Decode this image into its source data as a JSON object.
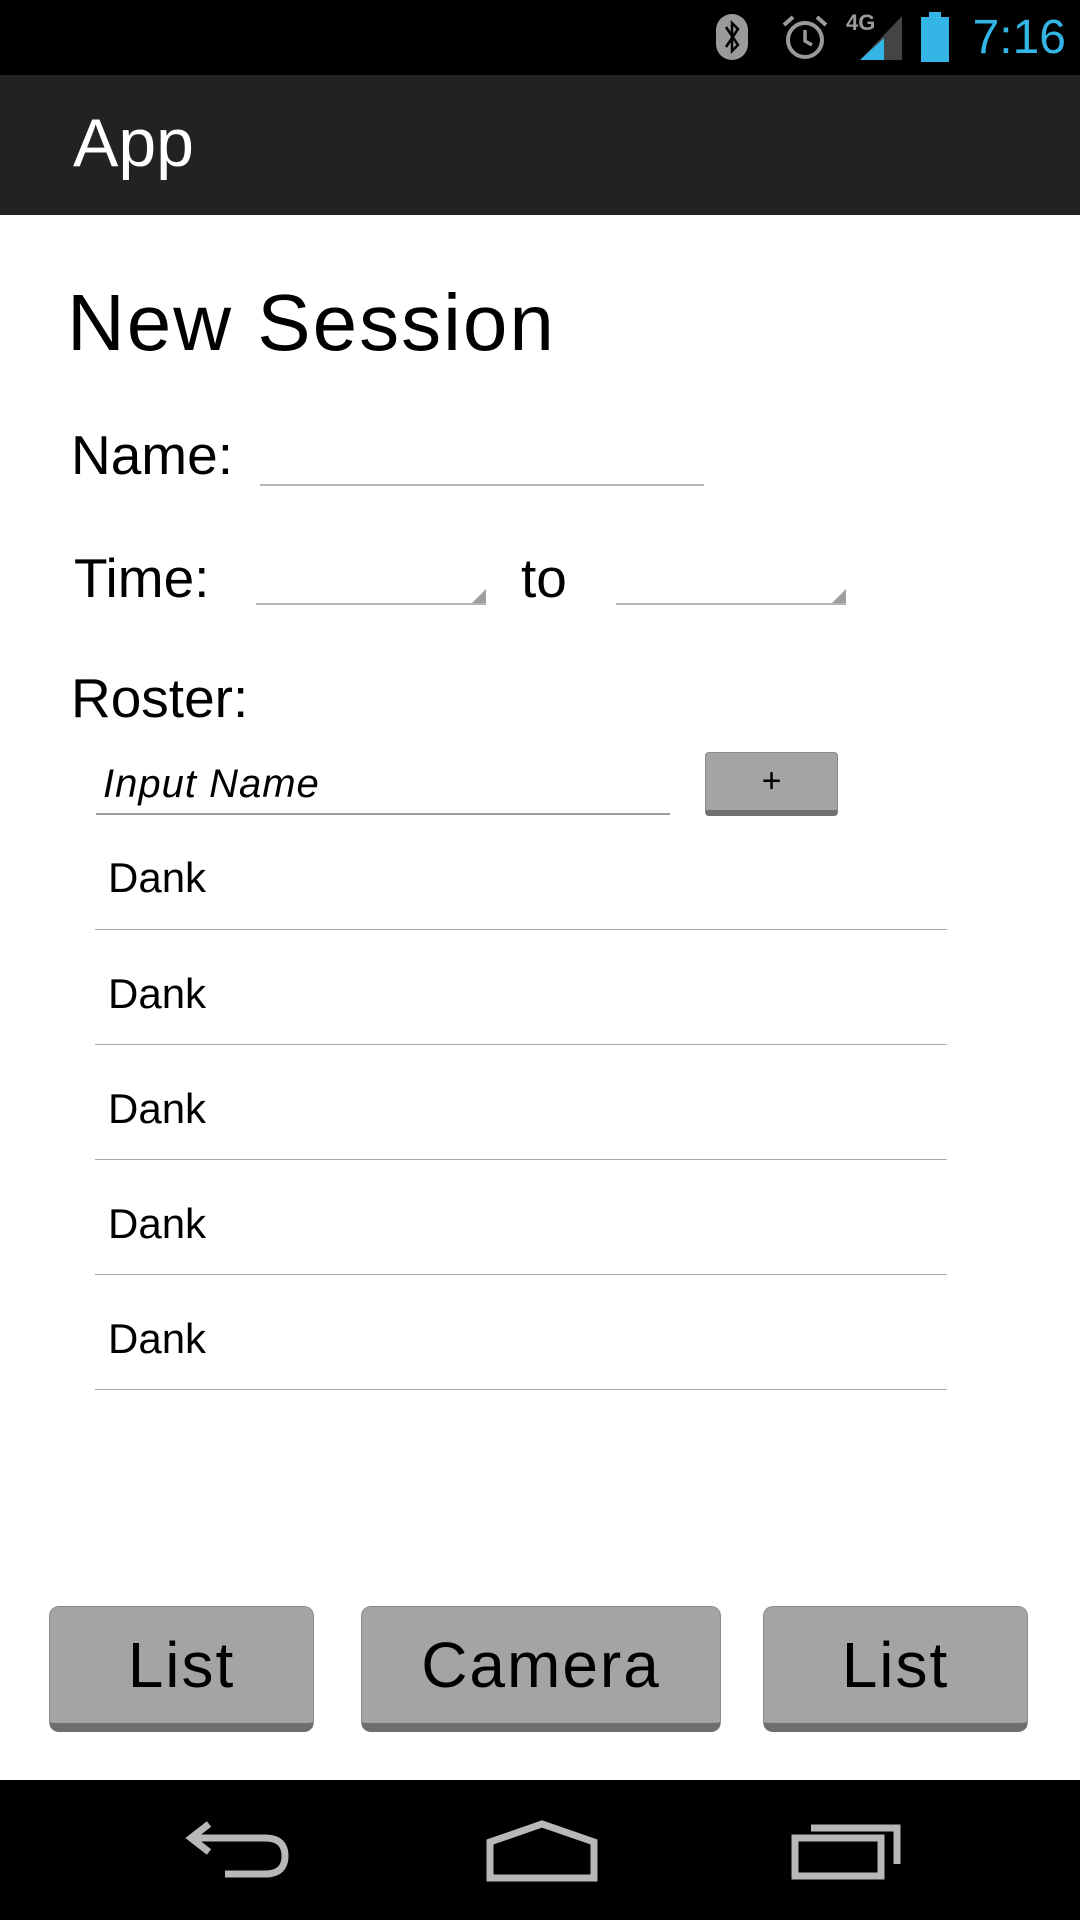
{
  "status_bar": {
    "time": "7:16",
    "network_label": "4G",
    "icons": [
      "bluetooth-icon",
      "alarm-icon",
      "signal-icon",
      "battery-icon"
    ],
    "time_color": "#33b5e5"
  },
  "action_bar": {
    "title": "App",
    "background": "#222222"
  },
  "main": {
    "title": "New Session",
    "name_label": "Name:",
    "name_value": "",
    "time_label": "Time:",
    "time_to_label": "to",
    "time_start_value": "",
    "time_end_value": "",
    "roster_label": "Roster:",
    "roster_input_placeholder": "Input Name",
    "add_button_label": "+",
    "roster_items": [
      "Dank",
      "Dank",
      "Dank",
      "Dank",
      "Dank"
    ]
  },
  "bottom_buttons": {
    "left_label": "List",
    "center_label": "Camera",
    "right_label": "List",
    "button_color": "#a4a4a4"
  },
  "nav_bar": {
    "icons": [
      "back-icon",
      "home-icon",
      "recent-apps-icon"
    ]
  }
}
